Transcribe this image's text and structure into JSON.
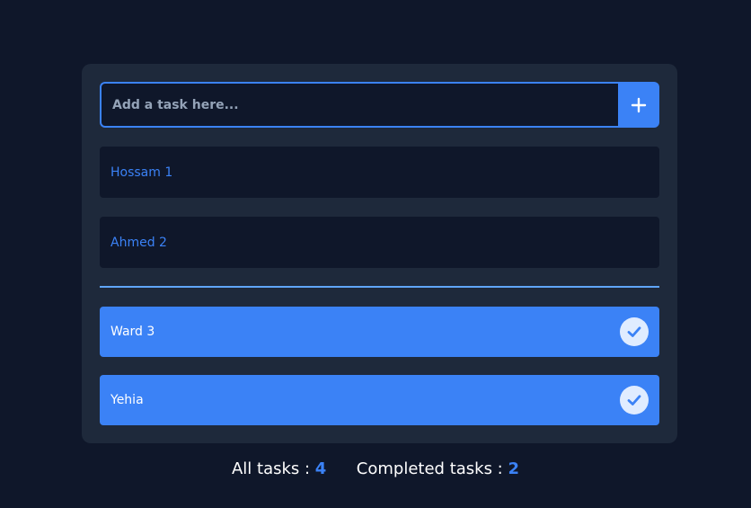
{
  "input": {
    "placeholder": "Add a task here...",
    "value": ""
  },
  "add_button": {
    "icon": "plus-icon"
  },
  "pending_tasks": [
    {
      "label": "Hossam 1"
    },
    {
      "label": "Ahmed 2"
    }
  ],
  "completed_tasks": [
    {
      "label": "Ward 3",
      "icon": "check-circle-icon"
    },
    {
      "label": "Yehia",
      "icon": "check-circle-icon"
    }
  ],
  "stats": {
    "all_label": "All tasks :",
    "all_count": "4",
    "completed_label": "Completed tasks :",
    "completed_count": "2"
  },
  "colors": {
    "background": "#0f172a",
    "card": "#1e293b",
    "accent": "#3b82f6",
    "divider": "#60a5fa",
    "check_bg": "#e0ecff"
  }
}
